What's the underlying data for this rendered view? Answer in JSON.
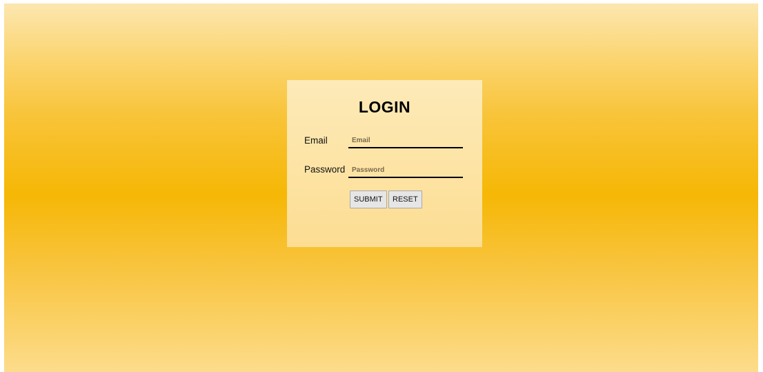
{
  "login": {
    "title": "LOGIN",
    "email_label": "Email",
    "email_placeholder": "Email",
    "email_value": "",
    "password_label": "Password",
    "password_placeholder": "Password",
    "password_value": "",
    "submit_label": "SUBMIT",
    "reset_label": "RESET"
  },
  "colors": {
    "background_center": "#f6b705",
    "background_edge": "#fce7b0",
    "card_background": "#fde4a6"
  }
}
